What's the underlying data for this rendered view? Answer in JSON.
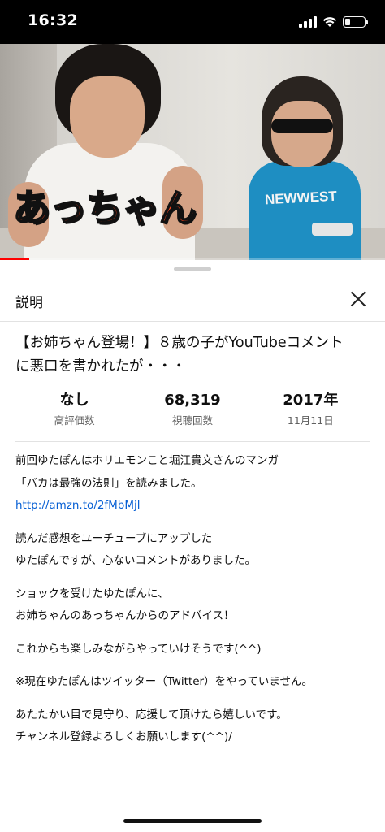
{
  "status_bar": {
    "time": "16:32"
  },
  "video": {
    "caption": "あっちゃん",
    "shirt_text": "NEWWEST",
    "progress": 0.075,
    "accent_color": "#ff0000"
  },
  "sheet": {
    "title": "説明",
    "video_title_line1": "【お姉ちゃん登場！】８歳の子がYouTubeコメント",
    "video_title_line2": "に悪口を書かれたが・・・",
    "stats": [
      {
        "value": "なし",
        "label": "高評価数"
      },
      {
        "value": "68,319",
        "label": "視聴回数"
      },
      {
        "value": "2017年",
        "label": "11月11日"
      }
    ],
    "description": {
      "p1_l1": "前回ゆたぽんはホリエモンこと堀江貴文さんのマンガ",
      "p1_l2": "「バカは最強の法則」を読みました。",
      "link": "http://amzn.to/2fMbMjl",
      "p2_l1": "読んだ感想をユーチューブにアップした",
      "p2_l2": "ゆたぽんですが、心ないコメントがありました。",
      "p3_l1": "ショックを受けたゆたぽんに、",
      "p3_l2": "お姉ちゃんのあっちゃんからのアドバイス！",
      "p4_l1": "これからも楽しみながらやっていけそうです(^^)",
      "p5_l1": "※現在ゆたぽんはツイッター（Twitter）をやっていません。",
      "p6_l1": "あたたかい目で見守り、応援して頂けたら嬉しいです。",
      "p6_l2": "チャンネル登録よろしくお願いします(^^)/"
    },
    "link_color": "#065fd4"
  },
  "icons": [
    "signal-icon",
    "wifi-icon",
    "battery-icon",
    "close-icon"
  ]
}
